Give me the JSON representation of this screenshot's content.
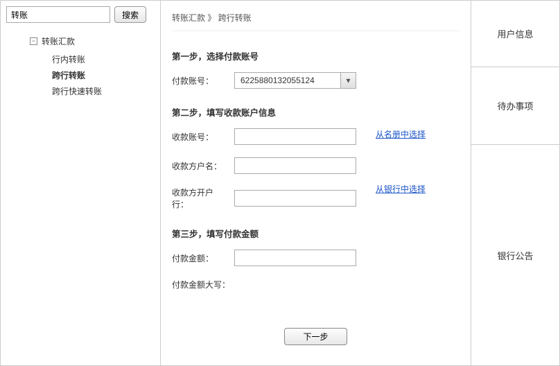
{
  "sidebar": {
    "search_value": "转账",
    "search_button": "搜索",
    "root_label": "转账汇款",
    "toggle_glyph": "⊟",
    "items": [
      {
        "label": "行内转账"
      },
      {
        "label": "跨行转账"
      },
      {
        "label": "跨行快速转账"
      }
    ]
  },
  "breadcrumb": {
    "parent": "转账汇款",
    "sep": "》",
    "current": "跨行转账"
  },
  "form": {
    "step1_title": "第一步，选择付款账号",
    "payer_account_label": "付款账号：",
    "payer_account_value": "6225880132055124",
    "step2_title": "第二步，填写收款账户信息",
    "payee_account_label": "收款账号：",
    "payee_account_value": "",
    "payee_name_label": "收款方户名：",
    "payee_name_value": "",
    "payee_bank_label": "收款方开户行：",
    "payee_bank_value": "",
    "link_from_roster": "从名册中选择",
    "link_from_bank": "从银行中选择",
    "step3_title": "第三步，填写付款金额",
    "amount_label": "付款金额：",
    "amount_value": "",
    "amount_cn_label": "付款金额大写：",
    "amount_cn_value": "",
    "next_button": "下一步"
  },
  "right": {
    "user_info": "用户信息",
    "todo": "待办事项",
    "notice": "银行公告"
  }
}
